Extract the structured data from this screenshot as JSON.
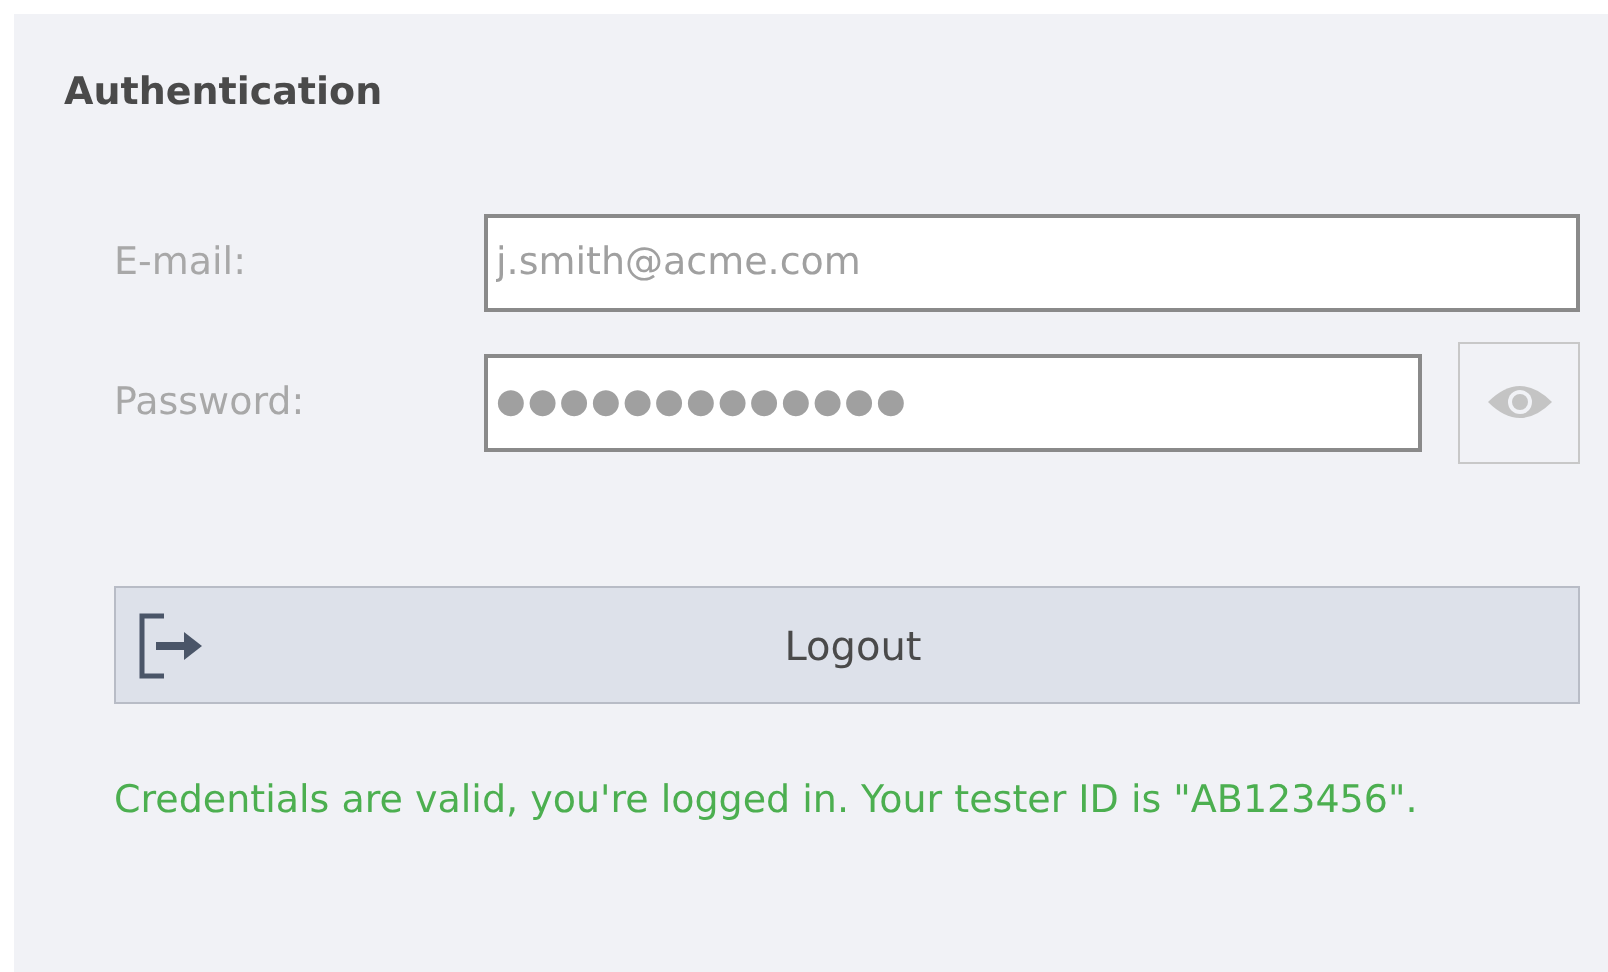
{
  "section": {
    "title": "Authentication"
  },
  "fields": [
    {
      "kind": "text",
      "label": "E-mail:",
      "value": "j.smith@acme.com",
      "disabled": true
    },
    {
      "kind": "password",
      "label": "Password:",
      "value": "●●●●●●●●●●●●●",
      "disabled": true
    }
  ],
  "logout_button": {
    "label": "Logout"
  },
  "status": {
    "text": "Credentials are valid, you're logged in. Your tester ID is \"AB123456\".",
    "color": "#4caf50"
  }
}
